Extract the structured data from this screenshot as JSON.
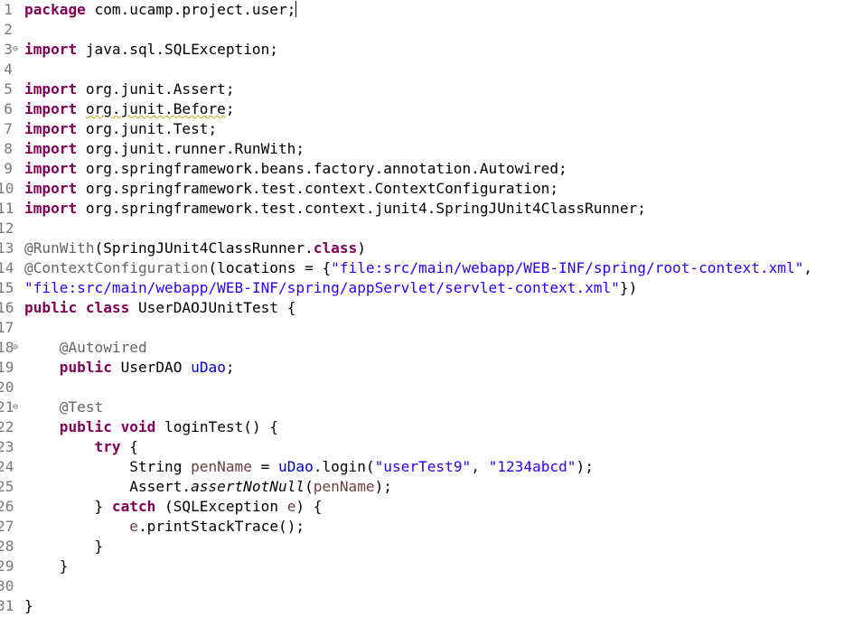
{
  "editor": {
    "lines": [
      {
        "num": "1",
        "fold": "",
        "tokens": [
          {
            "t": "package",
            "c": "kw"
          },
          {
            "t": " com.ucamp.project.user;",
            "c": ""
          }
        ],
        "caret": true
      },
      {
        "num": "2",
        "fold": "",
        "tokens": []
      },
      {
        "num": "3",
        "fold": "⊖",
        "tokens": [
          {
            "t": "import",
            "c": "kw"
          },
          {
            "t": " java.sql.SQLException;",
            "c": ""
          }
        ]
      },
      {
        "num": "4",
        "fold": "",
        "tokens": []
      },
      {
        "num": "5",
        "fold": "",
        "tokens": [
          {
            "t": "import",
            "c": "kw"
          },
          {
            "t": " org.junit.Assert;",
            "c": ""
          }
        ]
      },
      {
        "num": "6",
        "fold": "",
        "tokens": [
          {
            "t": "import",
            "c": "kw"
          },
          {
            "t": " ",
            "c": ""
          },
          {
            "t": "org.junit.Before",
            "c": "warn"
          },
          {
            "t": ";",
            "c": ""
          }
        ]
      },
      {
        "num": "7",
        "fold": "",
        "tokens": [
          {
            "t": "import",
            "c": "kw"
          },
          {
            "t": " org.junit.Test;",
            "c": ""
          }
        ]
      },
      {
        "num": "8",
        "fold": "",
        "tokens": [
          {
            "t": "import",
            "c": "kw"
          },
          {
            "t": " org.junit.runner.RunWith;",
            "c": ""
          }
        ]
      },
      {
        "num": "9",
        "fold": "",
        "tokens": [
          {
            "t": "import",
            "c": "kw"
          },
          {
            "t": " org.springframework.beans.factory.annotation.Autowired;",
            "c": ""
          }
        ]
      },
      {
        "num": "10",
        "fold": "",
        "tokens": [
          {
            "t": "import",
            "c": "kw"
          },
          {
            "t": " org.springframework.test.context.ContextConfiguration;",
            "c": ""
          }
        ]
      },
      {
        "num": "11",
        "fold": "",
        "tokens": [
          {
            "t": "import",
            "c": "kw"
          },
          {
            "t": " org.springframework.test.context.junit4.SpringJUnit4ClassRunner;",
            "c": ""
          }
        ]
      },
      {
        "num": "12",
        "fold": "",
        "tokens": []
      },
      {
        "num": "13",
        "fold": "",
        "tokens": [
          {
            "t": "@RunWith",
            "c": "ann"
          },
          {
            "t": "(SpringJUnit4ClassRunner.",
            "c": ""
          },
          {
            "t": "class",
            "c": "kw"
          },
          {
            "t": ")",
            "c": ""
          }
        ]
      },
      {
        "num": "14",
        "fold": "",
        "tokens": [
          {
            "t": "@ContextConfiguration",
            "c": "ann"
          },
          {
            "t": "(locations = {",
            "c": ""
          },
          {
            "t": "\"file:src/main/webapp/WEB-INF/spring/root-context.xml\"",
            "c": "str"
          },
          {
            "t": ",",
            "c": ""
          }
        ]
      },
      {
        "num": "15",
        "fold": "",
        "tokens": [
          {
            "t": "\"file:src/main/webapp/WEB-INF/spring/appServlet/servlet-context.xml\"",
            "c": "str"
          },
          {
            "t": "})",
            "c": ""
          }
        ]
      },
      {
        "num": "16",
        "fold": "",
        "tokens": [
          {
            "t": "public",
            "c": "kw"
          },
          {
            "t": " ",
            "c": ""
          },
          {
            "t": "class",
            "c": "kw"
          },
          {
            "t": " UserDAOJUnitTest {",
            "c": ""
          }
        ]
      },
      {
        "num": "17",
        "fold": "",
        "tokens": []
      },
      {
        "num": "18",
        "fold": "⊖",
        "tokens": [
          {
            "t": "    ",
            "c": ""
          },
          {
            "t": "@Autowired",
            "c": "ann"
          }
        ]
      },
      {
        "num": "19",
        "fold": "",
        "tokens": [
          {
            "t": "    ",
            "c": ""
          },
          {
            "t": "public",
            "c": "kw"
          },
          {
            "t": " UserDAO ",
            "c": ""
          },
          {
            "t": "uDao",
            "c": "fld"
          },
          {
            "t": ";",
            "c": ""
          }
        ]
      },
      {
        "num": "20",
        "fold": "",
        "tokens": []
      },
      {
        "num": "21",
        "fold": "⊖",
        "tokens": [
          {
            "t": "    ",
            "c": ""
          },
          {
            "t": "@Test",
            "c": "ann"
          }
        ]
      },
      {
        "num": "22",
        "fold": "",
        "tokens": [
          {
            "t": "    ",
            "c": ""
          },
          {
            "t": "public",
            "c": "kw"
          },
          {
            "t": " ",
            "c": ""
          },
          {
            "t": "void",
            "c": "kw"
          },
          {
            "t": " loginTest() {",
            "c": ""
          }
        ]
      },
      {
        "num": "23",
        "fold": "",
        "tokens": [
          {
            "t": "        ",
            "c": ""
          },
          {
            "t": "try",
            "c": "kw"
          },
          {
            "t": " {",
            "c": ""
          }
        ]
      },
      {
        "num": "24",
        "fold": "",
        "tokens": [
          {
            "t": "            String ",
            "c": ""
          },
          {
            "t": "penName",
            "c": "var"
          },
          {
            "t": " = ",
            "c": ""
          },
          {
            "t": "uDao",
            "c": "fld"
          },
          {
            "t": ".login(",
            "c": ""
          },
          {
            "t": "\"userTest9\"",
            "c": "str"
          },
          {
            "t": ", ",
            "c": ""
          },
          {
            "t": "\"1234abcd\"",
            "c": "str"
          },
          {
            "t": ");",
            "c": ""
          }
        ]
      },
      {
        "num": "25",
        "fold": "",
        "tokens": [
          {
            "t": "            Assert.",
            "c": ""
          },
          {
            "t": "assertNotNull",
            "c": "sm"
          },
          {
            "t": "(",
            "c": ""
          },
          {
            "t": "penName",
            "c": "var"
          },
          {
            "t": ");",
            "c": ""
          }
        ]
      },
      {
        "num": "26",
        "fold": "",
        "tokens": [
          {
            "t": "        } ",
            "c": ""
          },
          {
            "t": "catch",
            "c": "kw"
          },
          {
            "t": " (SQLException ",
            "c": ""
          },
          {
            "t": "e",
            "c": "var"
          },
          {
            "t": ") {",
            "c": ""
          }
        ]
      },
      {
        "num": "27",
        "fold": "",
        "tokens": [
          {
            "t": "            ",
            "c": ""
          },
          {
            "t": "e",
            "c": "var"
          },
          {
            "t": ".printStackTrace();",
            "c": ""
          }
        ]
      },
      {
        "num": "28",
        "fold": "",
        "tokens": [
          {
            "t": "        }",
            "c": ""
          }
        ]
      },
      {
        "num": "29",
        "fold": "",
        "tokens": [
          {
            "t": "    }",
            "c": ""
          }
        ]
      },
      {
        "num": "30",
        "fold": "",
        "tokens": []
      },
      {
        "num": "31",
        "fold": "",
        "tokens": [
          {
            "t": "}",
            "c": ""
          }
        ]
      }
    ]
  }
}
